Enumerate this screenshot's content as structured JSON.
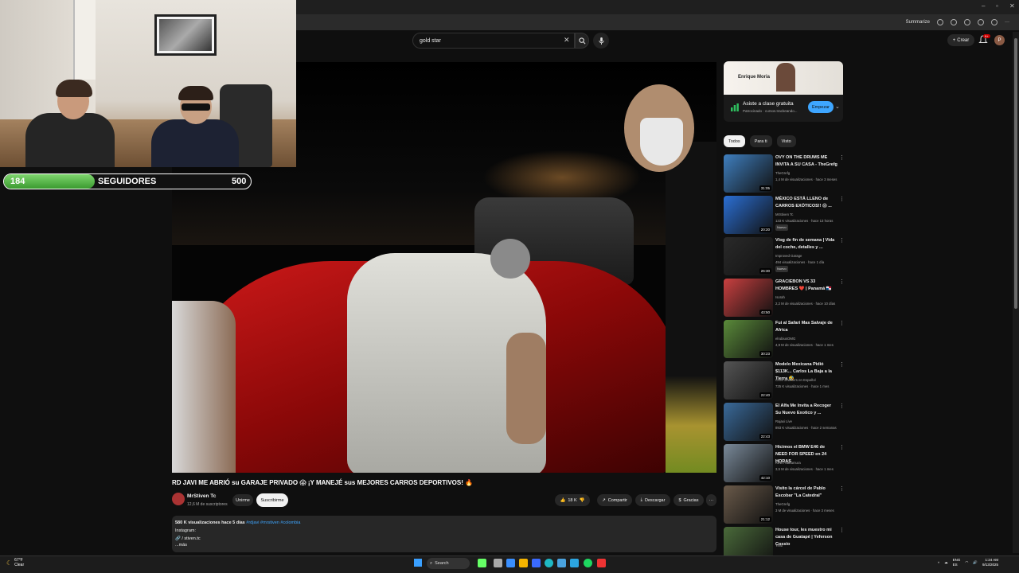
{
  "browser": {
    "toolbar_summarize": "Summarize",
    "profile_initial": "P"
  },
  "webcam": {
    "follower_count": "184",
    "follower_label": "SEGUIDORES",
    "follower_goal": "500",
    "follower_progress": 0.368
  },
  "header": {
    "search_value": "gold star",
    "create_label": "Crear",
    "notif_count": "9+"
  },
  "video": {
    "title": "RD JAVI ME ABRIÓ su GARAJE PRIVADO 😱 ¡Y MANEJÉ sus MEJORES CARROS DEPORTIVOS! 🔥",
    "channel_name": "MrStiven Tc",
    "channel_subs": "12,6 M de suscriptores",
    "join_label": "Unirme",
    "subscribe_label": "Suscribirme",
    "likes": "18 K",
    "share_label": "Compartir",
    "download_label": "Descargar",
    "thanks_label": "Gracias",
    "description": {
      "stats": "580 K visualizaciones  hace 5 días",
      "tags": "#rdjavi #mrstiven #colombia",
      "line2": "Instagram:",
      "line3": "🔗 / stiven.tc",
      "more": "...más"
    }
  },
  "ad": {
    "banner_name": "Enrique Moria",
    "title": "Asiste a clase gratuita",
    "sponsor": "Patrocinado · cursos.trackeando...",
    "cta": "Empezar"
  },
  "chips": [
    "Todos",
    "Para ti",
    "Visto"
  ],
  "recommendations": [
    {
      "title": "OVY ON THE DRUMS ME INVITA A SU CASA - TheGrefg",
      "channel": "TheGrefg",
      "meta": "1,4 M de visualizaciones · hace 3 meses",
      "duration": "31:05",
      "nuevo": "",
      "color": "#3f7fbf"
    },
    {
      "title": "MÉXICO ESTÁ LLENO de CARROS EXÓTICOS!! 😱 ...",
      "channel": "MrStiven Tc",
      "meta": "133 K visualizaciones · hace 13 horas",
      "duration": "20:20",
      "nuevo": "Nuevo",
      "color": "#2b6fd4"
    },
    {
      "title": "Vlog de fin de semana | Vida del coche, detalles y ...",
      "channel": "Improved Garage",
      "meta": "494 visualizaciones · hace 1 día",
      "duration": "26:30",
      "nuevo": "Nuevo",
      "color": "#2a2a2a"
    },
    {
      "title": "GRACIEBON VS 33 HOMBRES ❤️ | Panamá 🇵🇦",
      "channel": "Isorah",
      "meta": "2,2 M de visualizaciones · hace 10 días",
      "duration": "43:50",
      "nuevo": "",
      "color": "#c94040"
    },
    {
      "title": "Fui al Safari Mas Salvaje de Africa",
      "channel": "elrubiusOMG",
      "meta": "4,9 M de visualizaciones · hace 1 mes",
      "duration": "30:23",
      "nuevo": "",
      "color": "#5a8a3a"
    },
    {
      "title": "Modelo Mexicana Pidió $113K... Carlos La Baja a la Tierra 🤣",
      "channel": "CRM Jewelers en Español",
      "meta": "725 K visualizaciones · hace 1 mes",
      "duration": "22:40",
      "nuevo": "",
      "color": "#555"
    },
    {
      "title": "El Alfa Me Invita a Recoger Su Nuevo Exotico y ...",
      "channel": "Rajaxi Live",
      "meta": "893 K visualizaciones · hace 2 semanas",
      "duration": "22:43",
      "nuevo": "",
      "color": "#3a6a9a"
    },
    {
      "title": "Hicimos el BMW E46 de NEED FOR SPEED en 24 HORAS",
      "channel": "Kevin Nakamura",
      "meta": "3,5 M de visualizaciones · hace 1 mes",
      "duration": "42:10",
      "nuevo": "",
      "color": "#7a8a9a"
    },
    {
      "title": "Visito la cárcel de Pablo Escobar \"La Catedral\"",
      "channel": "TheGrefg",
      "meta": "3 M de visualizaciones · hace 3 meses",
      "duration": "21:12",
      "nuevo": "",
      "color": "#6a5a4a"
    },
    {
      "title": "House tour, les muestro mi casa de Guatapé | Yeferson Cossio",
      "channel": "Yefsi",
      "meta": "",
      "duration": "",
      "nuevo": "",
      "color": "#4a6a3a"
    }
  ],
  "taskbar": {
    "weather_temp": "67°F",
    "weather_desc": "Clear",
    "search_label": "Search",
    "lang": "ENG",
    "region": "ES",
    "time": "1:24 AM",
    "date": "9/13/2025"
  }
}
